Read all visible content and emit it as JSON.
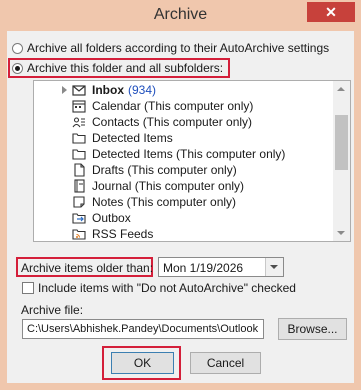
{
  "window": {
    "title": "Archive",
    "close_glyph": "✕"
  },
  "options": {
    "archive_all_label": "Archive all folders according to their AutoArchive settings",
    "archive_this_label": "Archive this folder and all subfolders:",
    "selected": "archive_this"
  },
  "folders": [
    {
      "label": "Inbox",
      "count": "(934)",
      "icon": "envelope-icon",
      "bold": true
    },
    {
      "label": "Calendar (This computer only)",
      "icon": "calendar-icon"
    },
    {
      "label": "Contacts (This computer only)",
      "icon": "contact-card-icon"
    },
    {
      "label": "Detected Items",
      "icon": "folder-icon"
    },
    {
      "label": "Detected Items (This computer only)",
      "icon": "folder-icon"
    },
    {
      "label": "Drafts (This computer only)",
      "icon": "draft-page-icon"
    },
    {
      "label": "Journal (This computer only)",
      "icon": "journal-icon"
    },
    {
      "label": "Notes (This computer only)",
      "icon": "note-icon"
    },
    {
      "label": "Outbox",
      "icon": "outbox-icon"
    },
    {
      "label": "RSS Feeds",
      "icon": "rss-feed-icon"
    }
  ],
  "older_than": {
    "label": "Archive items older than:",
    "value": "Mon 1/19/2026"
  },
  "include_no_autoarchive": {
    "label": "Include items with \"Do not AutoArchive\" checked",
    "checked": false
  },
  "archive_file": {
    "label": "Archive file:",
    "value": "C:\\Users\\Abhishek.Pandey\\Documents\\Outlook",
    "browse_label": "Browse..."
  },
  "buttons": {
    "ok_label": "OK",
    "cancel_label": "Cancel"
  },
  "colors": {
    "window_frame": "#f0c7ad",
    "close_button": "#c7413b",
    "highlight_border": "#d41f3a",
    "inbox_count": "#1f4fbd"
  }
}
